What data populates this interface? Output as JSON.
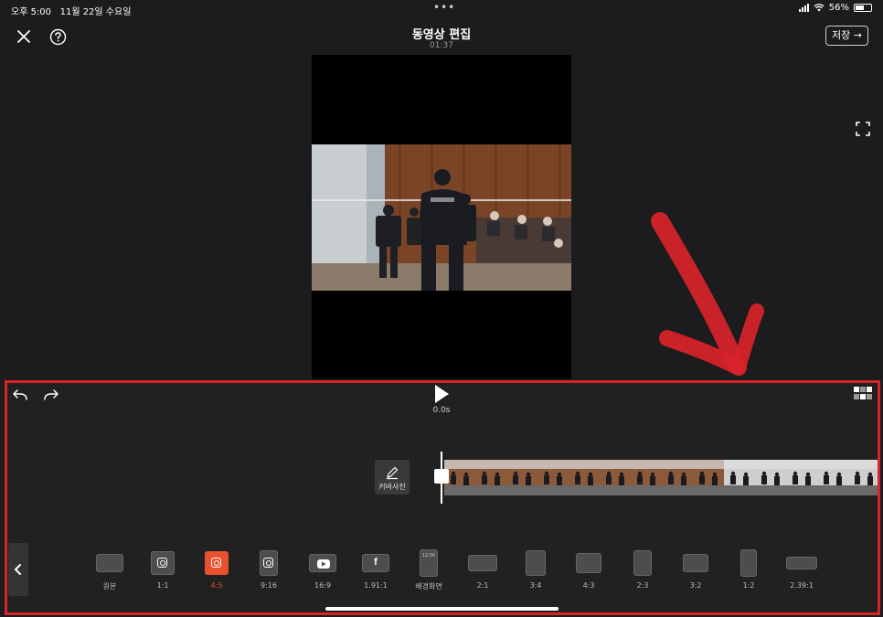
{
  "status": {
    "time": "오후 5:00",
    "date": "11월 22일 수요일",
    "battery": "56%",
    "battery_level": 0.56
  },
  "header": {
    "title": "동영상 편집",
    "duration": "01:37",
    "save_label": "저장 →"
  },
  "player": {
    "time": "0.0s"
  },
  "cover": {
    "label": "커버사진"
  },
  "ratios": [
    {
      "label": "원본",
      "icon": "rect-icon"
    },
    {
      "label": "1:1",
      "icon": "instagram-icon"
    },
    {
      "label": "4:5",
      "icon": "instagram-icon",
      "active": true
    },
    {
      "label": "9:16",
      "icon": "instagram-icon"
    },
    {
      "label": "16:9",
      "icon": "youtube-icon"
    },
    {
      "label": "1.91:1",
      "icon": "facebook-icon"
    },
    {
      "label": "배경화면",
      "icon": "phone-icon",
      "sub": "12:00"
    },
    {
      "label": "2:1",
      "icon": "rect-icon"
    },
    {
      "label": "3:4",
      "icon": "rect-icon"
    },
    {
      "label": "4:3",
      "icon": "rect-icon"
    },
    {
      "label": "2:3",
      "icon": "rect-icon"
    },
    {
      "label": "3:2",
      "icon": "rect-icon"
    },
    {
      "label": "1:2",
      "icon": "rect-icon"
    },
    {
      "label": "2.39:1",
      "icon": "rect-icon"
    }
  ],
  "colors": {
    "accent": "#e8502f",
    "annotation": "#d8232a",
    "panel": "#212121",
    "background": "#1c1c1e"
  }
}
